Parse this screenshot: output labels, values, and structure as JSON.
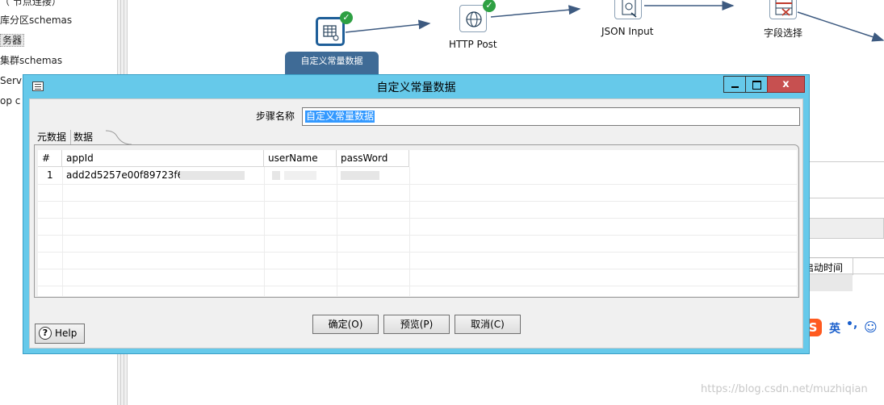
{
  "left_panel": {
    "items": [
      {
        "label": "（ 节点连接）"
      },
      {
        "label": "库分区schemas"
      },
      {
        "label": "务器",
        "selected": true
      },
      {
        "label": "集群schemas"
      },
      {
        "label": "Servi"
      },
      {
        "label": "op c"
      }
    ]
  },
  "canvas": {
    "steps": [
      {
        "label": "自定义常量数据",
        "status": "ok",
        "selected": true
      },
      {
        "label": "HTTP Post",
        "status": "ok"
      },
      {
        "label": "JSON Input"
      },
      {
        "label": "字段选择"
      }
    ],
    "background_column_header": "启动时间"
  },
  "dialog": {
    "title": "自定义常量数据",
    "close_label": "x",
    "step_name_label": "步骤名称",
    "step_name_value": "自定义常量数据",
    "tabs": [
      "元数据",
      "数据"
    ],
    "active_tab": "数据",
    "table": {
      "columns": [
        "#",
        "appId",
        "userName",
        "passWord"
      ],
      "rows": [
        {
          "index": "1",
          "appId": "add2d5257e00f89723f69",
          "userName": "",
          "passWord": ""
        }
      ]
    },
    "buttons": {
      "ok": "确定(O)",
      "preview": "预览(P)",
      "cancel": "取消(C)",
      "help": "Help",
      "help_icon_glyph": "?"
    }
  },
  "ime": {
    "logo": "S",
    "lang": "英",
    "punct": "•,",
    "emoji": "☺"
  },
  "watermark": "https://blog.csdn.net/muzhiqian"
}
